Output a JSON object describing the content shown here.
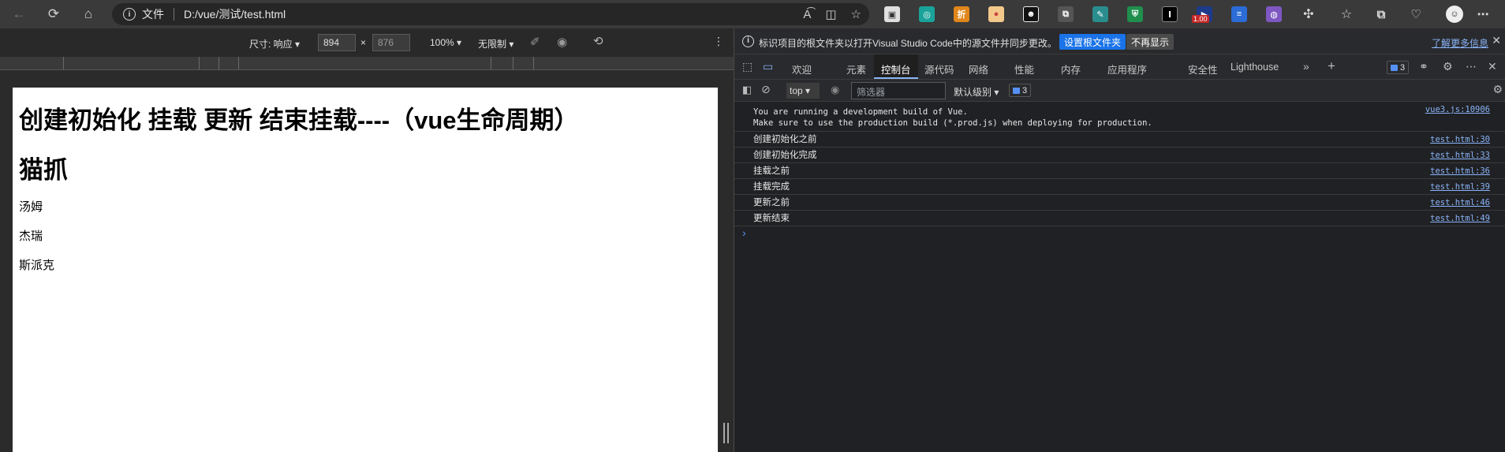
{
  "browser": {
    "address": {
      "scheme_label": "文件",
      "url": "D:/vue/测试/test.html"
    },
    "ext_badge": "1.00"
  },
  "device_toolbar": {
    "dimensions_label": "尺寸: 响应",
    "width": "894",
    "times": "×",
    "height": "876",
    "zoom": "100%",
    "throttle": "无限制"
  },
  "page": {
    "heading": "创建初始化 挂载 更新 结束挂载----（vue生命周期）",
    "subheading": "猫抓",
    "items": [
      "汤姆",
      "杰瑞",
      "斯派克"
    ]
  },
  "devtools": {
    "infobar": {
      "message": "标识项目的根文件夹以打开Visual Studio Code中的源文件并同步更改。",
      "primary_button": "设置根文件夹",
      "secondary_button": "不再显示",
      "learn_more": "了解更多信息"
    },
    "tabs": [
      "欢迎",
      "元素",
      "控制台",
      "源代码",
      "网络",
      "性能",
      "内存",
      "应用程序",
      "安全性",
      "Lighthouse"
    ],
    "issues_count": "3",
    "console_toolbar": {
      "context": "top",
      "filter_placeholder": "筛选器",
      "level": "默认级别",
      "issues_count": "3"
    },
    "console": {
      "vue_warning": {
        "line1": "You are running a development build of Vue.",
        "line2": "Make sure to use the production build (*.prod.js) when deploying for production.",
        "source": "vue3.js:10906"
      },
      "logs": [
        {
          "text": "创建初始化之前",
          "source": "test.html:30"
        },
        {
          "text": "创建初始化完成",
          "source": "test.html:33"
        },
        {
          "text": "挂载之前",
          "source": "test.html:36"
        },
        {
          "text": "挂载完成",
          "source": "test.html:39"
        },
        {
          "text": "更新之前",
          "source": "test.html:46"
        },
        {
          "text": "更新结束",
          "source": "test.html:49"
        }
      ],
      "prompt": "›"
    }
  }
}
